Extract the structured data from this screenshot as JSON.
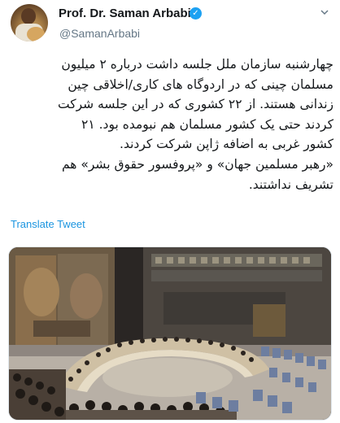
{
  "author": {
    "name": "Prof. Dr. Saman Arbabi",
    "handle": "@SamanArbabi",
    "verified_mark": "✓"
  },
  "tweet": {
    "lines": [
      "چهارشنبه سازمان ملل جلسه داشت درباره ۲ میلیون",
      "مسلمان چینی که در اردوگاه های کاری/اخلاقی چین",
      "زندانی هستند. از ۲۲ کشوری که در این جلسه شرکت",
      "کردند حتی یک کشور مسلمان هم نبومده بود. ۲۱",
      "کشور غربی به اضافه ژاپن شرکت کردند.",
      "«رهبر مسلمین جهان» و «پروفسور حقوق بشر» هم",
      "تشریف نداشتند."
    ]
  },
  "actions": {
    "translate_label": "Translate Tweet"
  },
  "icons": {
    "verified": "verified-badge-icon",
    "menu": "chevron-down-icon"
  },
  "colors": {
    "link": "#1b95e0",
    "verified": "#1da1f2",
    "handle": "#657786"
  }
}
